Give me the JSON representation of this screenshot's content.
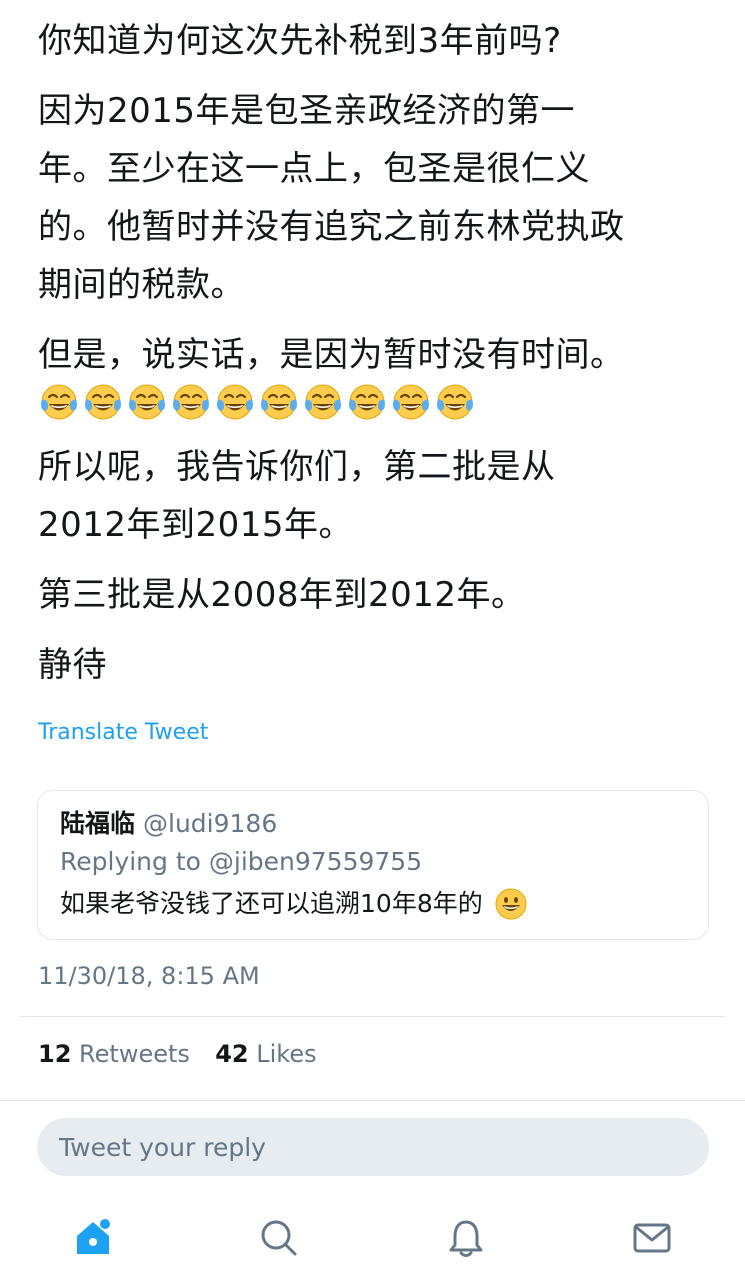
{
  "tweet": {
    "paragraphs": [
      "你知道为何这次先补税到3年前吗?",
      "因为2015年是包圣亲政经济的第一\n年。至少在这一点上，包圣是很仁义\n的。他暂时并没有追究之前东林党执政\n期间的税款。",
      "但是，说实话，是因为暂时没有时间。",
      "所以呢，我告诉你们，第二批是从\n2012年到2015年。",
      "第三批是从2008年到2012年。",
      "静待"
    ],
    "emoji_count": 10,
    "emoji_icon": "face-with-tears-of-joy-icon",
    "translate_label": "Translate Tweet"
  },
  "quote": {
    "name": "陆福临",
    "handle": "@ludi9186",
    "replying_to": "Replying to @jiben97559755",
    "text": "如果老爷没钱了还可以追溯10年8年的",
    "emoji_icon": "grinning-face-icon"
  },
  "timestamp": "11/30/18, 8:15 AM",
  "stats": {
    "retweets_count": "12",
    "retweets_label": "Retweets",
    "likes_count": "42",
    "likes_label": "Likes"
  },
  "reply": {
    "placeholder": "Tweet your reply"
  },
  "tabbar": {
    "items": [
      "home-icon",
      "search-icon",
      "notifications-icon",
      "messages-icon"
    ],
    "accent": "#1da1f2",
    "inactive": "#657786"
  }
}
